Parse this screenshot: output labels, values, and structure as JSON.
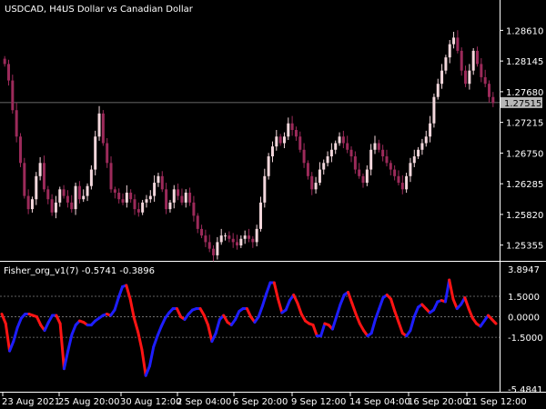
{
  "main_chart": {
    "symbol": "USDCAD, H4:",
    "title": "US Dollar vs Canadian Dollar",
    "price_ticks": [
      "1.28610",
      "1.28145",
      "1.27680",
      "1.27215",
      "1.26750",
      "1.26285",
      "1.25820",
      "1.25355"
    ],
    "current_price": "1.27515"
  },
  "indicator": {
    "label": "Fisher_org_v1(7) -0.5741 -0.3896",
    "ticks": [
      "3.8947",
      "1.5000",
      "0.0000",
      "-1.5000",
      "-5.4841"
    ]
  },
  "x_axis": {
    "labels": [
      "23 Aug 2021",
      "25 Aug 20:00",
      "30 Aug 12:00",
      "2 Sep 04:00",
      "6 Sep 20:00",
      "9 Sep 12:00",
      "14 Sep 04:00",
      "16 Sep 20:00",
      "21 Sep 12:00"
    ]
  },
  "colors": {
    "background": "#000000",
    "grid": "#7f7f7f",
    "text": "#ffffff",
    "bull_candle": "#f3d7dc",
    "bear_candle": "#9c2a5a",
    "fisher_up": "#1e1eff",
    "fisher_down": "#ff1414",
    "price_badge": "#b7b7b7"
  },
  "chart_data": [
    {
      "type": "candlestick",
      "title": "USDCAD, H4: US Dollar vs Canadian Dollar",
      "ylim": [
        1.2513,
        1.2907
      ],
      "close_series": [
        1.281,
        1.2785,
        1.274,
        1.27,
        1.266,
        1.261,
        1.259,
        1.2605,
        1.264,
        1.266,
        1.262,
        1.2605,
        1.2585,
        1.26,
        1.262,
        1.261,
        1.26,
        1.259,
        1.2625,
        1.2605,
        1.261,
        1.2625,
        1.265,
        1.27,
        1.2735,
        1.269,
        1.266,
        1.262,
        1.2615,
        1.2605,
        1.26,
        1.2615,
        1.2605,
        1.259,
        1.2585,
        1.26,
        1.2605,
        1.261,
        1.263,
        1.264,
        1.262,
        1.259,
        1.26,
        1.262,
        1.261,
        1.26,
        1.2615,
        1.26,
        1.258,
        1.256,
        1.255,
        1.254,
        1.253,
        1.252,
        1.254,
        1.255,
        1.255,
        1.2545,
        1.254,
        1.2535,
        1.2545,
        1.255,
        1.2545,
        1.254,
        1.256,
        1.26,
        1.264,
        1.267,
        1.2685,
        1.27,
        1.269,
        1.27,
        1.272,
        1.271,
        1.27,
        1.268,
        1.266,
        1.264,
        1.262,
        1.263,
        1.265,
        1.266,
        1.267,
        1.268,
        1.269,
        1.27,
        1.269,
        1.268,
        1.267,
        1.265,
        1.264,
        1.263,
        1.265,
        1.268,
        1.269,
        1.268,
        1.267,
        1.266,
        1.265,
        1.264,
        1.263,
        1.262,
        1.264,
        1.266,
        1.267,
        1.268,
        1.269,
        1.27,
        1.272,
        1.276,
        1.278,
        1.28,
        1.282,
        1.284,
        1.285,
        1.283,
        1.28,
        1.278,
        1.28,
        1.283,
        1.281,
        1.279,
        1.278,
        1.276,
        1.2751
      ]
    },
    {
      "type": "line",
      "title": "Fisher_org_v1(7)",
      "ylim": [
        -5.4841,
        3.8947
      ],
      "reference_levels": [
        1.5,
        0.0,
        -1.5
      ],
      "series": [
        {
          "name": "Fisher_org_v1(7)",
          "values": [
            0.2,
            -0.5,
            -2.5,
            -1.8,
            -0.8,
            -0.1,
            0.2,
            0.2,
            0.1,
            0.0,
            -0.6,
            -1.0,
            -0.4,
            0.1,
            0.1,
            -0.5,
            -3.8,
            -2.5,
            -1.3,
            -0.6,
            -0.3,
            -0.4,
            -0.6,
            -0.6,
            -0.3,
            -0.1,
            0.1,
            0.2,
            0.1,
            0.5,
            1.4,
            2.2,
            2.3,
            1.3,
            -0.1,
            -1.1,
            -2.4,
            -4.3,
            -3.6,
            -2.2,
            -1.4,
            -0.7,
            -0.1,
            0.3,
            0.6,
            0.6,
            0.0,
            -0.2,
            0.2,
            0.5,
            0.6,
            0.6,
            0.1,
            -0.6,
            -1.8,
            -1.2,
            -0.2,
            0.1,
            -0.4,
            -0.6,
            -0.2,
            0.4,
            0.6,
            0.6,
            0.0,
            -0.4,
            0.0,
            0.8,
            1.7,
            2.5,
            2.5,
            1.3,
            0.3,
            0.5,
            1.2,
            1.6,
            1.0,
            0.2,
            -0.3,
            -0.5,
            -0.6,
            -1.4,
            -1.4,
            -0.5,
            -0.6,
            -0.9,
            0.0,
            0.9,
            1.6,
            1.8,
            1.0,
            0.2,
            -0.5,
            -1.0,
            -1.4,
            -1.2,
            -0.2,
            0.6,
            1.4,
            1.6,
            1.3,
            0.4,
            -0.4,
            -1.2,
            -1.4,
            -1.0,
            0.0,
            0.7,
            0.9,
            0.6,
            0.3,
            0.5,
            1.1,
            1.2,
            1.1,
            2.7,
            1.3,
            0.6,
            0.9,
            1.4,
            0.6,
            -0.1,
            -0.5,
            -0.7,
            -0.3,
            0.1,
            -0.2,
            -0.5
          ]
        }
      ]
    }
  ]
}
